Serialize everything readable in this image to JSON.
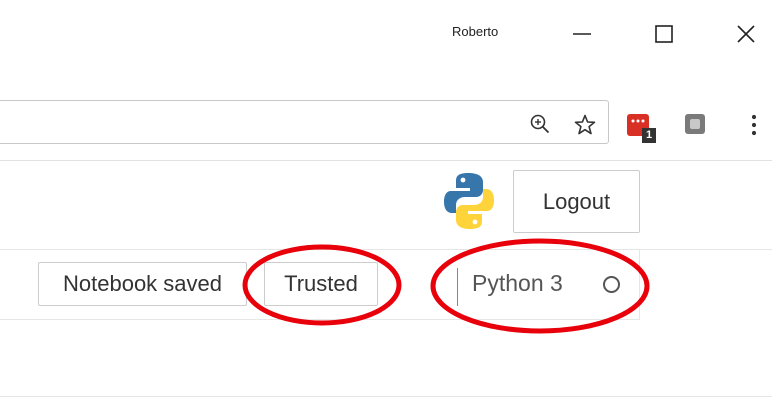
{
  "window": {
    "profile_name": "Roberto",
    "minimize_icon": "minimize-icon",
    "maximize_icon": "maximize-icon",
    "close_icon": "close-icon"
  },
  "toolbar": {
    "zoom_icon": "zoom-in-icon",
    "bookmark_icon": "star-icon",
    "extension_1_badge": "1",
    "menu_icon": "vertical-dots-icon"
  },
  "jupyter": {
    "logout_label": "Logout",
    "notebook_status": "Notebook saved",
    "trusted_label": "Trusted",
    "kernel_name": "Python 3"
  },
  "colors": {
    "annotation": "#e8000b",
    "extension_red": "#d93025",
    "python_blue": "#3776ab",
    "python_yellow": "#ffd43b"
  }
}
